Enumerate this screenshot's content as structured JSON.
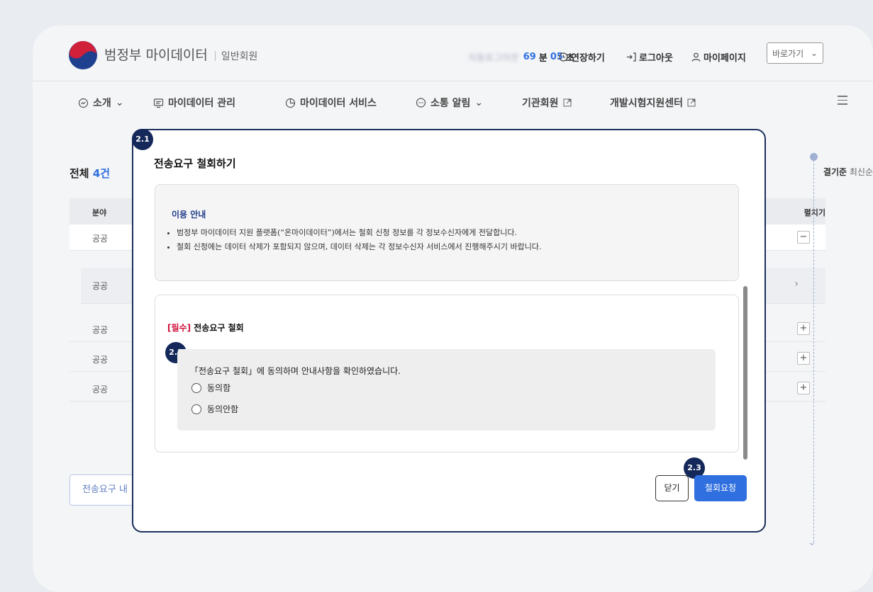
{
  "header": {
    "brand": "범정부 마이데이터",
    "role": "일반회원",
    "session_masked": "자동로그아웃",
    "session_minutes": "69",
    "session_minutes_unit": "분",
    "session_seconds": "05",
    "session_seconds_unit": "초",
    "extend_label": "연장하기",
    "logout_label": "로그아웃",
    "mypage_label": "마이페이지",
    "goto_label": "바로가기"
  },
  "nav": {
    "items": [
      {
        "label": "소개",
        "icon": "intro-icon",
        "dropdown": true
      },
      {
        "label": "마이데이터 관리",
        "icon": "manage-icon",
        "dropdown": false
      },
      {
        "label": "마이데이터 서비스",
        "icon": "service-icon",
        "dropdown": false
      },
      {
        "label": "소통 알림",
        "icon": "chat-icon",
        "dropdown": true
      },
      {
        "label": "기관회원",
        "icon": "external-link-icon",
        "dropdown": false
      },
      {
        "label": "개발시험지원센터",
        "icon": "external-link-icon",
        "dropdown": false
      }
    ]
  },
  "list": {
    "total_prefix": "전체",
    "total_count": "4건",
    "sort_label": "결기준",
    "sort_value": "최신순",
    "col_field": "분야",
    "col_expand": "펼치기",
    "rows": [
      "공공",
      "공공",
      "공공",
      "공공",
      "공공"
    ],
    "bottom_button": "전송요구 내"
  },
  "modal": {
    "badge_modal": "2.1",
    "badge_consent": "2.2",
    "badge_submit": "2.3",
    "title": "전송요구 철회하기",
    "info_title": "이용 안내",
    "info_items": [
      "범정부 마이데이터 지원 플랫폼(“온마이데이터”)에서는 철회 신청 정보를 각 정보수신자에게 전달합니다.",
      "철회 신청에는 데이터 삭제가 포함되지 않으며, 데이터 삭제는 각 정보수신자 서비스에서 진행해주시기 바랍니다."
    ],
    "required_tag": "[필수]",
    "required_label": "전송요구 철회",
    "question": "「전송요구 철회」에 동의하며 안내사항을 확인하였습니다.",
    "option_agree": "동의함",
    "option_disagree": "동의안함",
    "close_label": "닫기",
    "submit_label": "철회요청"
  },
  "colors": {
    "accent": "#2f6fe0",
    "modal_border": "#1c2f5c",
    "badge": "#14285a",
    "required": "#d0103a"
  }
}
